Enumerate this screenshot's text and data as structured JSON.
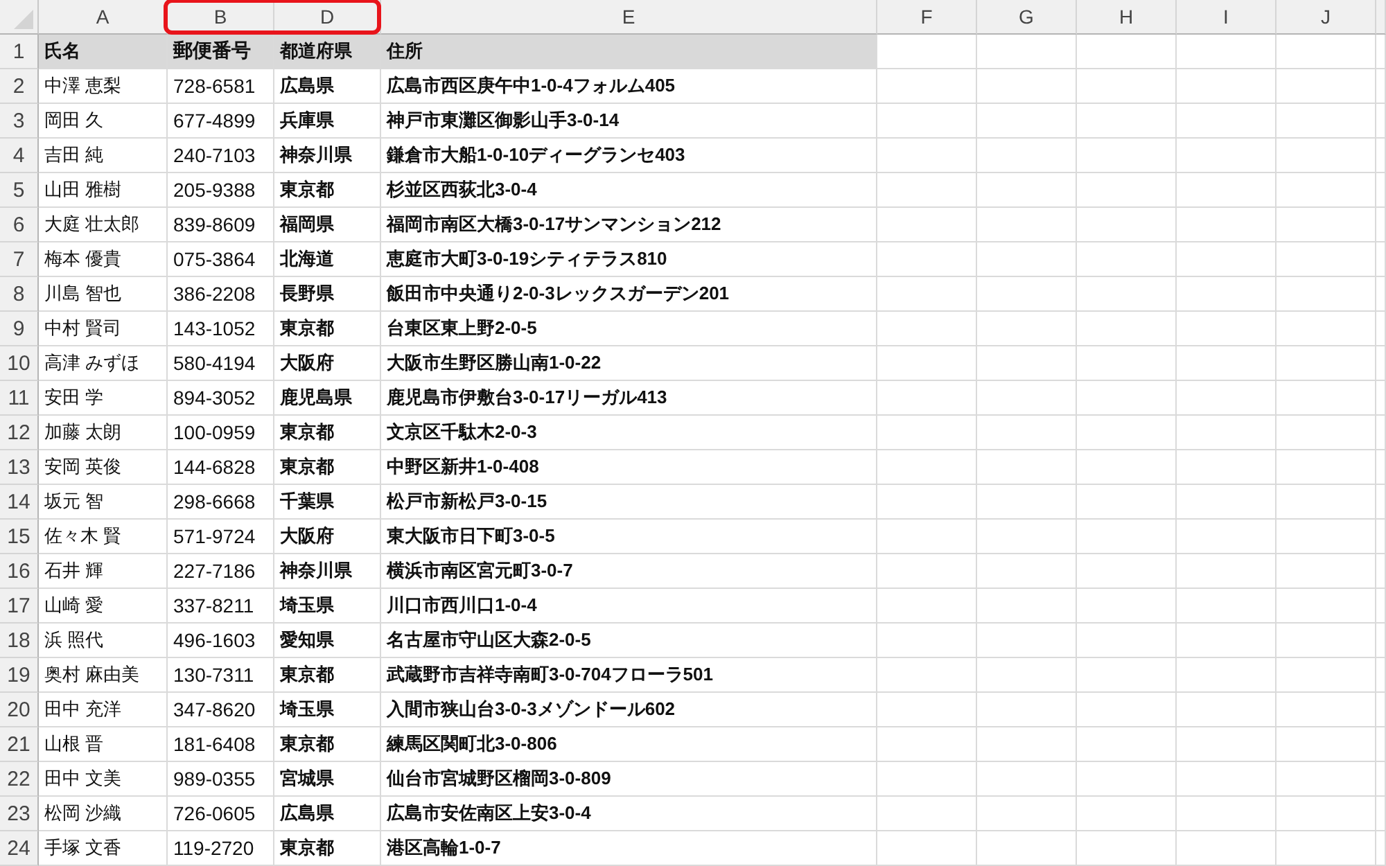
{
  "columns": [
    {
      "label": "A",
      "highlighted": false
    },
    {
      "label": "B",
      "highlighted": true
    },
    {
      "label": "D",
      "highlighted": true
    },
    {
      "label": "E",
      "highlighted": false
    },
    {
      "label": "F",
      "highlighted": false
    },
    {
      "label": "G",
      "highlighted": false
    },
    {
      "label": "H",
      "highlighted": false
    },
    {
      "label": "I",
      "highlighted": false
    },
    {
      "label": "J",
      "highlighted": false
    }
  ],
  "header_row": {
    "number": "1",
    "cells": [
      "氏名",
      "郵便番号",
      "都道府県",
      "住所"
    ]
  },
  "rows": [
    {
      "number": "2",
      "cells": [
        "中澤 恵梨",
        "728-6581",
        "広島県",
        "広島市西区庚午中1-0-4フォルム405"
      ]
    },
    {
      "number": "3",
      "cells": [
        "岡田 久",
        "677-4899",
        "兵庫県",
        "神戸市東灘区御影山手3-0-14"
      ]
    },
    {
      "number": "4",
      "cells": [
        "吉田 純",
        "240-7103",
        "神奈川県",
        "鎌倉市大船1-0-10ディーグランセ403"
      ]
    },
    {
      "number": "5",
      "cells": [
        "山田 雅樹",
        "205-9388",
        "東京都",
        "杉並区西荻北3-0-4"
      ]
    },
    {
      "number": "6",
      "cells": [
        "大庭 壮太郎",
        "839-8609",
        "福岡県",
        "福岡市南区大橋3-0-17サンマンション212"
      ]
    },
    {
      "number": "7",
      "cells": [
        "梅本 優貴",
        "075-3864",
        "北海道",
        "恵庭市大町3-0-19シティテラス810"
      ]
    },
    {
      "number": "8",
      "cells": [
        "川島 智也",
        "386-2208",
        "長野県",
        "飯田市中央通り2-0-3レックスガーデン201"
      ]
    },
    {
      "number": "9",
      "cells": [
        "中村 賢司",
        "143-1052",
        "東京都",
        "台東区東上野2-0-5"
      ]
    },
    {
      "number": "10",
      "cells": [
        "高津 みずほ",
        "580-4194",
        "大阪府",
        "大阪市生野区勝山南1-0-22"
      ]
    },
    {
      "number": "11",
      "cells": [
        "安田 学",
        "894-3052",
        "鹿児島県",
        "鹿児島市伊敷台3-0-17リーガル413"
      ]
    },
    {
      "number": "12",
      "cells": [
        "加藤 太朗",
        "100-0959",
        "東京都",
        "文京区千駄木2-0-3"
      ]
    },
    {
      "number": "13",
      "cells": [
        "安岡 英俊",
        "144-6828",
        "東京都",
        "中野区新井1-0-408"
      ]
    },
    {
      "number": "14",
      "cells": [
        "坂元 智",
        "298-6668",
        "千葉県",
        "松戸市新松戸3-0-15"
      ]
    },
    {
      "number": "15",
      "cells": [
        "佐々木 賢",
        "571-9724",
        "大阪府",
        "東大阪市日下町3-0-5"
      ]
    },
    {
      "number": "16",
      "cells": [
        "石井 輝",
        "227-7186",
        "神奈川県",
        "横浜市南区宮元町3-0-7"
      ]
    },
    {
      "number": "17",
      "cells": [
        "山崎 愛",
        "337-8211",
        "埼玉県",
        "川口市西川口1-0-4"
      ]
    },
    {
      "number": "18",
      "cells": [
        "浜 照代",
        "496-1603",
        "愛知県",
        "名古屋市守山区大森2-0-5"
      ]
    },
    {
      "number": "19",
      "cells": [
        "奥村 麻由美",
        "130-7311",
        "東京都",
        "武蔵野市吉祥寺南町3-0-704フローラ501"
      ]
    },
    {
      "number": "20",
      "cells": [
        "田中 充洋",
        "347-8620",
        "埼玉県",
        "入間市狭山台3-0-3メゾンドール602"
      ]
    },
    {
      "number": "21",
      "cells": [
        "山根 晋",
        "181-6408",
        "東京都",
        "練馬区関町北3-0-806"
      ]
    },
    {
      "number": "22",
      "cells": [
        "田中 文美",
        "989-0355",
        "宮城県",
        "仙台市宮城野区榴岡3-0-809"
      ]
    },
    {
      "number": "23",
      "cells": [
        "松岡 沙織",
        "726-0605",
        "広島県",
        "広島市安佐南区上安3-0-4"
      ]
    },
    {
      "number": "24",
      "cells": [
        "手塚 文香",
        "119-2720",
        "東京都",
        "港区高輪1-0-7"
      ]
    }
  ]
}
